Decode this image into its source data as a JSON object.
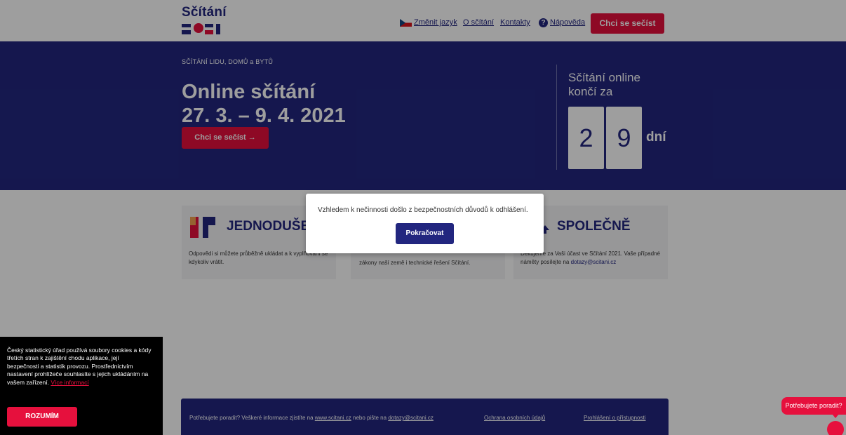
{
  "header": {
    "logo_word": "Sčítání",
    "logo_year": "2021",
    "nav": {
      "change_language": "Změnit jazyk",
      "about": "O sčítání",
      "contacts": "Kontakty",
      "help": "Nápověda"
    },
    "cta": "Chci se sečíst"
  },
  "hero": {
    "eyebrow": "SČÍTÁNÍ LIDU, DOMŮ a BYTŮ",
    "title": "Online sčítání",
    "dates": "27. 3. – 9. 4. 2021",
    "cta": "Chci se sečíst  →",
    "countdown": {
      "title": "Sčítání online končí za",
      "digit1": "2",
      "digit2": "9",
      "unit": "dní"
    }
  },
  "cards": {
    "card1": {
      "heading": "JEDNODUŠE",
      "text": "Odpovědi si můžete průběžně ukládat a k vyplňování se kdykoliv vrátit."
    },
    "card2": {
      "text": "zákony naší země i technické řešení Sčítání."
    },
    "card3": {
      "heading": "SPOLEČNĚ",
      "text_prefix": "Děkujeme za Vaši účast ve Sčítání 2021. Vaše případné náměty posílejte na",
      "email": "dotazy@scitani.cz"
    }
  },
  "modal": {
    "message": "Vzhledem k nečinnosti došlo z bezpečnostních důvodů k odhlášení.",
    "button": "Pokračovat"
  },
  "cookie": {
    "text": "Český statistický úřad používá soubory cookies a kódy třetích stran k zajištění chodu aplikace, její bezpečnosti a statistik provozu. Prostřednictvím nastavení prohlížeče souhlasíte s jejich ukládáním na vašem zařízení.",
    "more_link": "Více informací",
    "button": "ROZUMÍM"
  },
  "footer": {
    "text_prefix": "Potřebujete poradit? Veškeré informace zjistíte na",
    "site_link": "www.scitani.cz",
    "text_middle": "nebo pište na",
    "email_link": "dotazy@scitani.cz",
    "privacy_link": "Ochrana osobních údajů",
    "accessibility_link": "Prohlášení o přístupnosti"
  },
  "help_bubble": {
    "label": "Potřebujete poradit?"
  },
  "colors": {
    "brand_blue": "#22267f",
    "brand_red": "#e6103d"
  }
}
